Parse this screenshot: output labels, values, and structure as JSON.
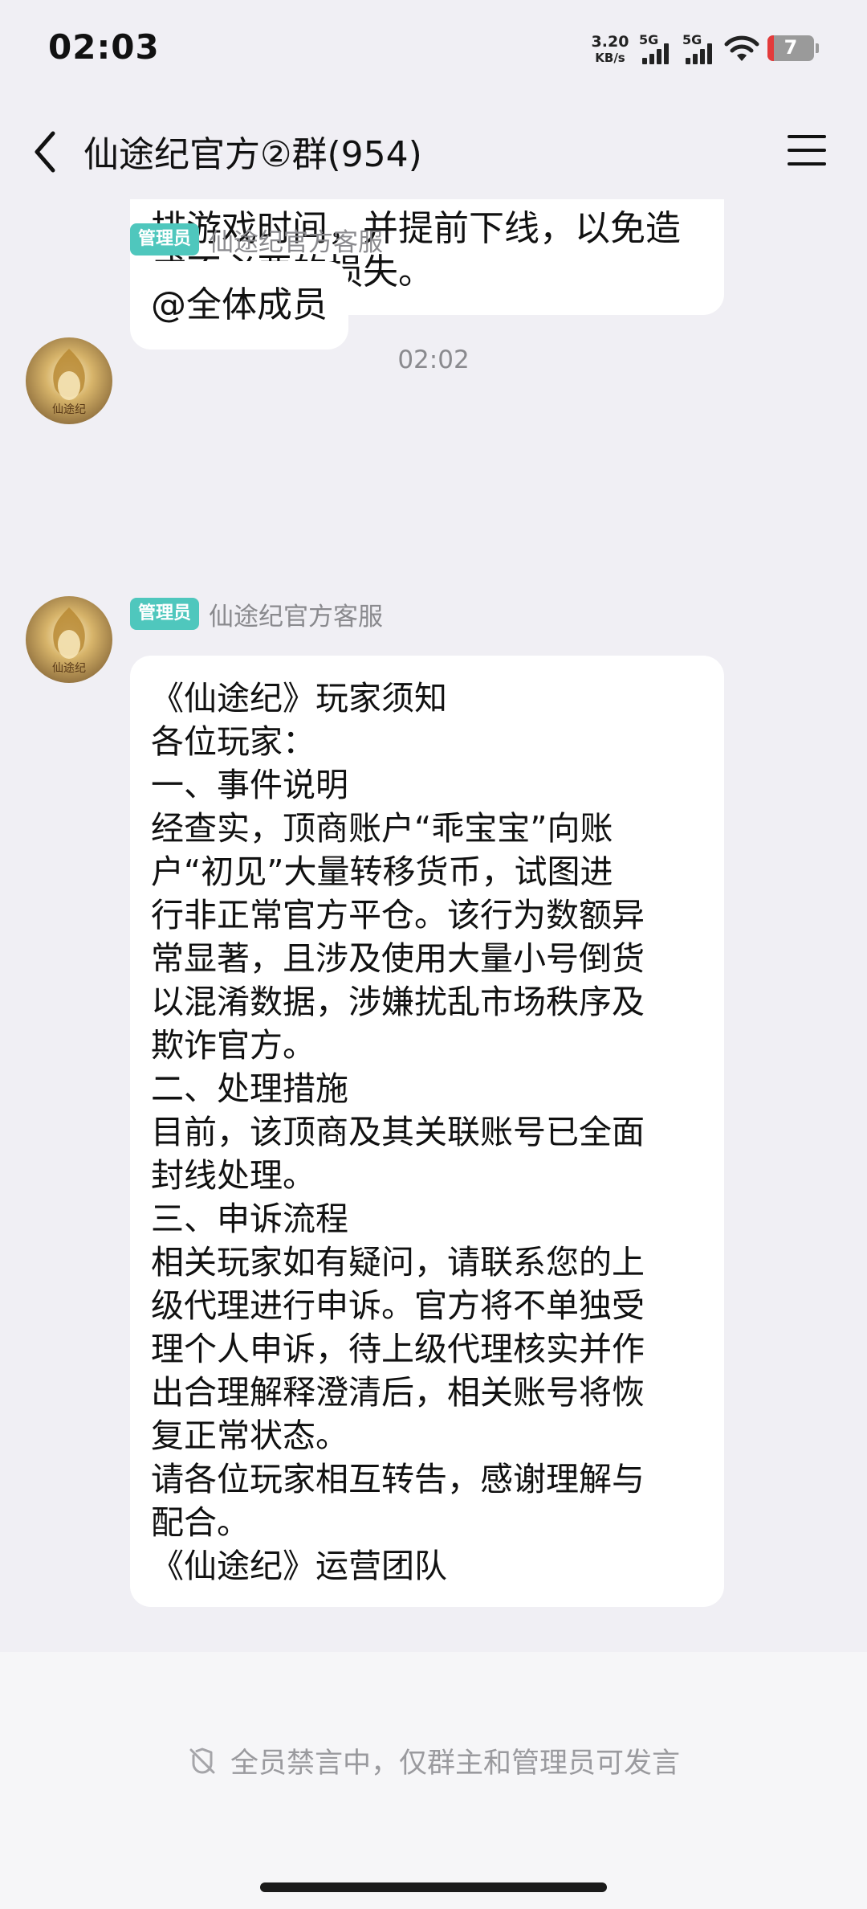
{
  "status_bar": {
    "time": "02:03",
    "net_speed_value": "3.20",
    "net_speed_unit": "KB/s",
    "signal1_label": "5G",
    "signal2_label": "5G",
    "battery_level": "7",
    "icons": [
      "signal-icon",
      "wifi-icon",
      "battery-icon"
    ]
  },
  "nav": {
    "title": "仙途纪官方②群(954)",
    "back_icon": "chevron-left-icon",
    "menu_icon": "menu-icon"
  },
  "messages": {
    "first_bubble_lines": [
      "排游戏时间，并提前下线，以免造",
      "成不必要的损失。"
    ],
    "msg1": {
      "badge": "管理员",
      "sender": "仙途纪官方客服",
      "text": "@全体成员"
    },
    "time_separator": "02:02",
    "msg2": {
      "badge": "管理员",
      "sender": "仙途纪官方客服",
      "lines": [
        "《仙途纪》玩家须知",
        "各位玩家：",
        "一、事件说明",
        "经查实，顶商账户“乖宝宝”向账",
        "户“初见”大量转移货币，试图进",
        "行非正常官方平仓。该行为数额异",
        "常显著，且涉及使用大量小号倒货",
        "以混淆数据，涉嫌扰乱市场秩序及",
        "欺诈官方。",
        "二、处理措施",
        "目前，该顶商及其关联账号已全面",
        "封线处理。",
        "三、申诉流程",
        "相关玩家如有疑问，请联系您的上",
        "级代理进行申诉。官方将不单独受",
        "理个人申诉，待上级代理核实并作",
        "出合理解释澄清后，相关账号将恢",
        "复正常状态。",
        "请各位玩家相互转告，感谢理解与",
        "配合。",
        "《仙途纪》运营团队"
      ]
    }
  },
  "bottom": {
    "muted_text": "全员禁言中，仅群主和管理员可发言",
    "muted_icon": "mute-icon"
  },
  "colors": {
    "background": "#f0eff4",
    "badge": "#4fc7bd",
    "bubble": "#ffffff",
    "secondary_text": "#8a8a8e"
  }
}
